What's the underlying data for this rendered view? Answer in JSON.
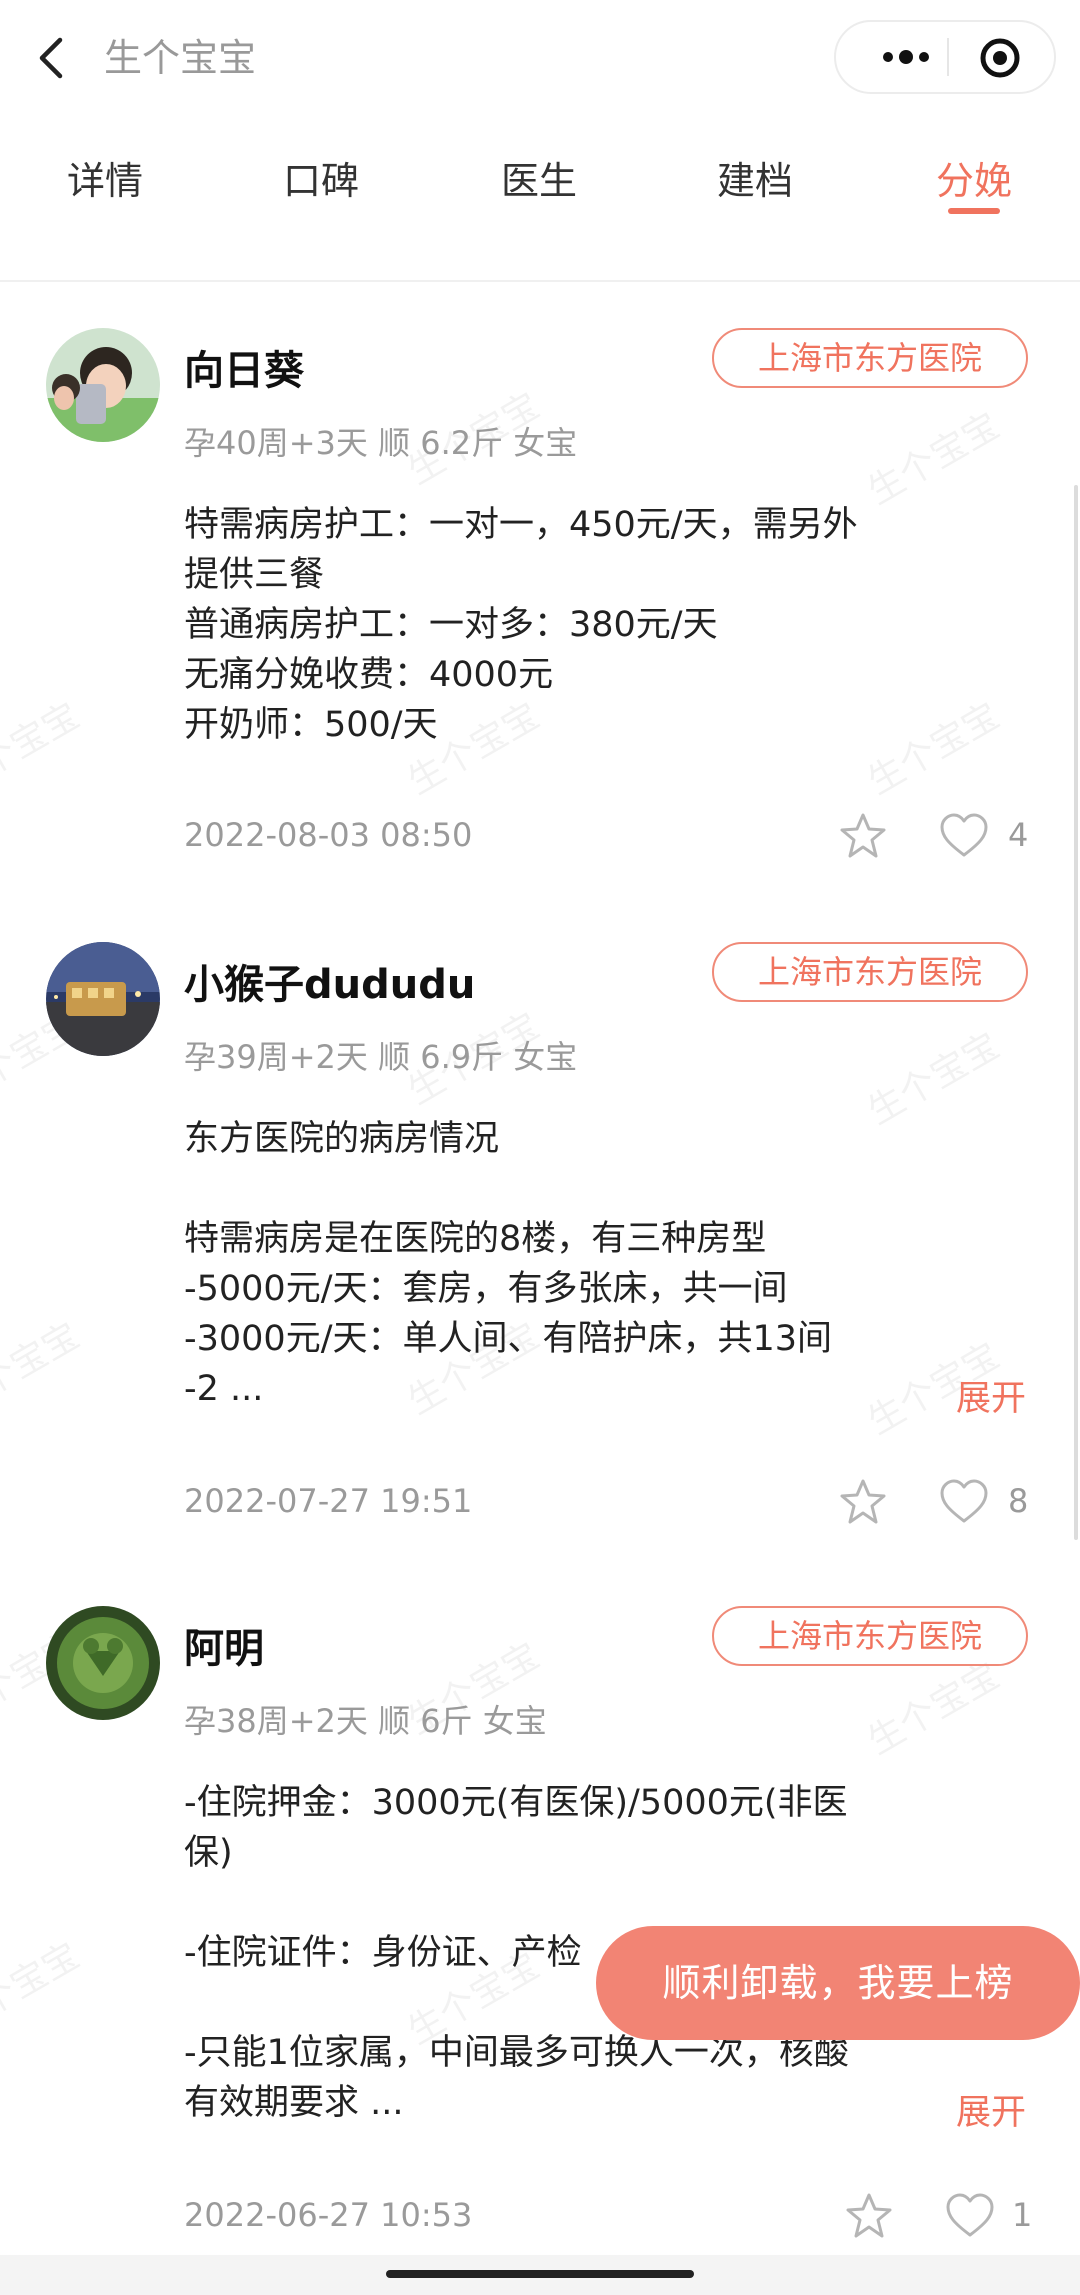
{
  "nav": {
    "title": "生个宝宝",
    "back_icon": "chevron-left-icon",
    "more_icon": "more-dots-icon",
    "close_icon": "target-circle-icon"
  },
  "tabs": [
    {
      "label": "详情",
      "active": false
    },
    {
      "label": "口碑",
      "active": false
    },
    {
      "label": "医生",
      "active": false
    },
    {
      "label": "建档",
      "active": false
    },
    {
      "label": "分娩",
      "active": true
    }
  ],
  "watermark": "生个宝宝",
  "accent_color": "#f0735e",
  "posts": [
    {
      "name": "向日葵",
      "hospital": "上海市东方医院",
      "meta": "孕40周+3天 顺 6.2斤 女宝",
      "lines": [
        "特需病房护工：一对一，450元/天，需另外",
        "提供三餐",
        "普通病房护工：一对多：380元/天",
        "无痛分娩收费：4000元",
        "开奶师：500/天"
      ],
      "expand": "",
      "date": "2022-08-03 08:50",
      "likes": "4"
    },
    {
      "name": "小猴子dududu",
      "hospital": "上海市东方医院",
      "meta": "孕39周+2天 顺 6.9斤 女宝",
      "lines": [
        "东方医院的病房情况",
        "",
        "特需病房是在医院的8楼，有三种房型",
        "-5000元/天：套房，有多张床，共一间",
        "-3000元/天：单人间、有陪护床，共13间",
        "-2 ..."
      ],
      "expand": "展开",
      "date": "2022-07-27 19:51",
      "likes": "8"
    },
    {
      "name": "阿明",
      "hospital": "上海市东方医院",
      "meta": "孕38周+2天 顺 6斤 女宝",
      "lines": [
        "-住院押金：3000元(有医保)/5000元(非医",
        "保)",
        "",
        "-住院证件：身份证、产检",
        "",
        "-只能1位家属，中间最多可换人一次，核酸",
        "有效期要求 ..."
      ],
      "expand": "展开",
      "date": "2022-06-27 10:53",
      "likes": "1"
    }
  ],
  "fab_label": "顺利卸载，我要上榜"
}
